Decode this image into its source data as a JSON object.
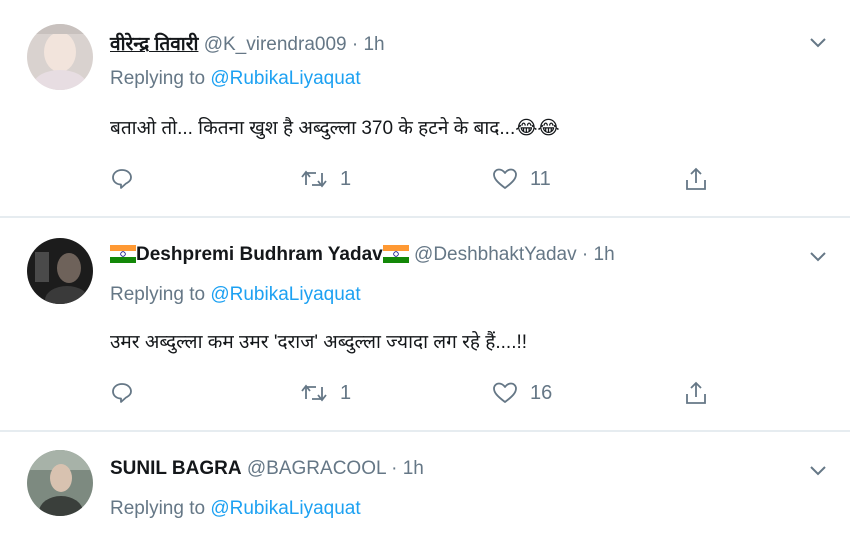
{
  "tweets": [
    {
      "name": "वीरेन्द्र तिवारी",
      "handle": "@K_virendra009",
      "time": "1h",
      "replying_prefix": "Replying to",
      "replying_handle": "@RubikaLiyaquat",
      "text": "बताओ तो... कितना खुश है अब्दुल्ला 370 के हटने के बाद...😂😂",
      "retweets": "1",
      "likes": "11"
    },
    {
      "name": "Deshpremi Budhram Yadav",
      "handle": "@DeshbhaktYadav",
      "time": "1h",
      "replying_prefix": "Replying to",
      "replying_handle": "@RubikaLiyaquat",
      "text": "उमर अब्दुल्ला कम उमर 'दराज' अब्दुल्ला ज्यादा लग रहे हैं....!!",
      "retweets": "1",
      "likes": "16"
    },
    {
      "name": "SUNIL BAGRA",
      "handle": "@BAGRACOOL",
      "time": "1h",
      "replying_prefix": "Replying to",
      "replying_handle": "@RubikaLiyaquat"
    }
  ],
  "colors": {
    "link": "#1da1f2",
    "muted": "#657786",
    "text": "#14171a"
  },
  "icons": [
    "chevron-down-icon",
    "reply-icon",
    "retweet-icon",
    "like-icon",
    "share-icon",
    "india-flag-icon"
  ]
}
